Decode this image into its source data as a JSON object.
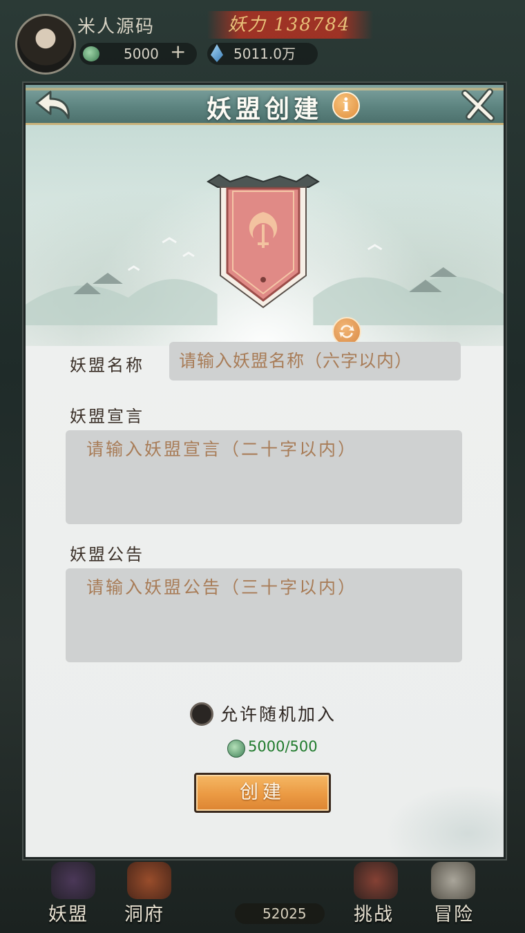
{
  "hud": {
    "player_name": "米人源码",
    "power_text": "妖力 138784",
    "jade_amount": "5000",
    "plus_symbol": "+",
    "crystal_amount": "5011.0万"
  },
  "dialog": {
    "title": "妖盟创建",
    "info_symbol": "i",
    "name_label": "妖盟名称",
    "name_placeholder": "请输入妖盟名称（六字以内）",
    "declaration_label": "妖盟宣言",
    "declaration_placeholder": "请输入妖盟宣言（二十字以内）",
    "notice_label": "妖盟公告",
    "notice_placeholder": "请输入妖盟公告（三十字以内）",
    "allow_random_join_label": "允许随机加入",
    "allow_random_join_checked": true,
    "cost_text": "5000/500",
    "create_button_label": "创建"
  },
  "bottom_nav": {
    "items": [
      "妖盟",
      "洞府",
      "挑战",
      "冒险"
    ],
    "center_count": "52025"
  },
  "colors": {
    "title_bar": "#5e8581",
    "banner_red": "#e08a86",
    "create_button": "#eb9a43",
    "placeholder_text": "#a87c57",
    "cost_text": "#1f7a2c"
  }
}
